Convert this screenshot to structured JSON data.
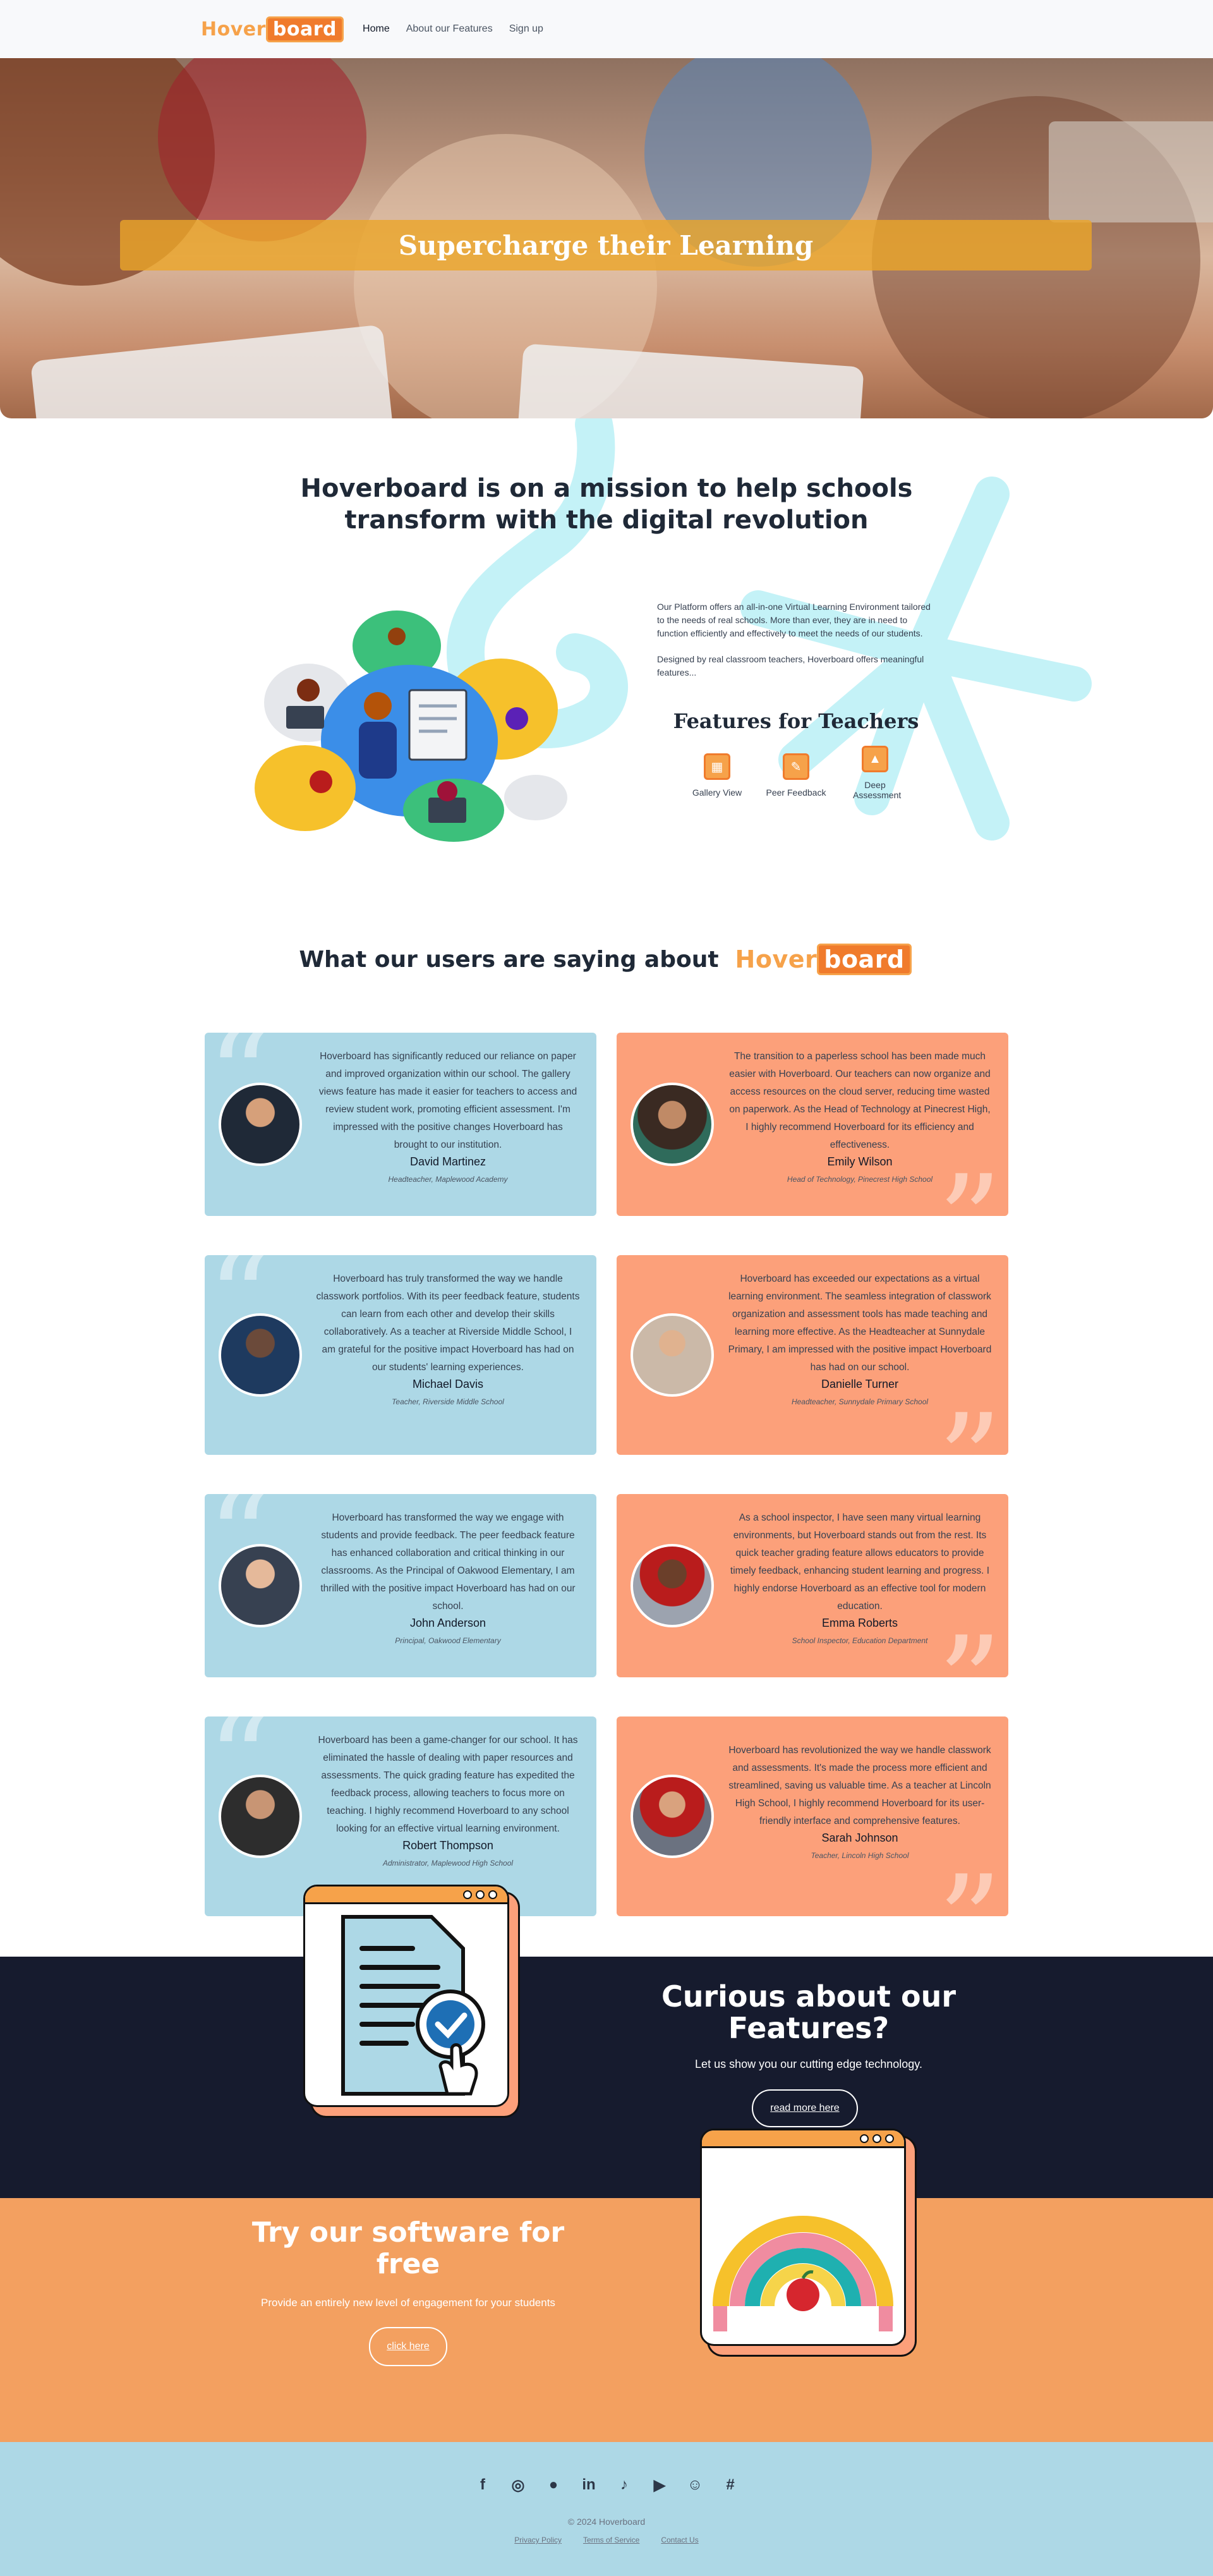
{
  "brand": {
    "part1": "Hover",
    "part2": "board"
  },
  "nav": {
    "home": "Home",
    "features": "About our Features",
    "signup": "Sign up"
  },
  "hero": {
    "title": "Supercharge their Learning"
  },
  "mission": {
    "title_line1": "Hoverboard is on a mission to help schools",
    "title_line2": "transform with the digital revolution",
    "p1": "Our Platform offers an all-in-one Virtual Learning Environment tailored to the needs of real schools. More than ever, they are in need to function efficiently and effectively to meet the needs of our students.",
    "p2": "Designed by real classroom teachers, Hoverboard offers meaningful features...",
    "features_title": "Features for Teachers",
    "features": [
      {
        "label": "Gallery View",
        "icon": "gallery-icon"
      },
      {
        "label": "Peer Feedback",
        "icon": "feedback-icon"
      },
      {
        "label": "Deep Assessment",
        "icon": "chart-icon"
      }
    ]
  },
  "testimonials": {
    "title": "What our users are saying about",
    "items": [
      {
        "quote": "Hoverboard has significantly reduced our reliance on paper and improved organization within our school. The gallery views feature has made it easier for teachers to access and review student work, promoting efficient assessment. I'm impressed with the positive changes Hoverboard has brought to our institution.",
        "name": "David Martinez",
        "role": "Headteacher, Maplewood Academy"
      },
      {
        "quote": "The transition to a paperless school has been made much easier with Hoverboard. Our teachers can now organize and access resources on the cloud server, reducing time wasted on paperwork. As the Head of Technology at Pinecrest High, I highly recommend Hoverboard for its efficiency and effectiveness.",
        "name": "Emily Wilson",
        "role": "Head of Technology, Pinecrest High School"
      },
      {
        "quote": "Hoverboard has truly transformed the way we handle classwork portfolios. With its peer feedback feature, students can learn from each other and develop their skills collaboratively. As a teacher at Riverside Middle School, I am grateful for the positive impact Hoverboard has had on our students' learning experiences.",
        "name": "Michael Davis",
        "role": "Teacher, Riverside Middle School"
      },
      {
        "quote": "Hoverboard has exceeded our expectations as a virtual learning environment. The seamless integration of classwork organization and assessment tools has made teaching and learning more effective. As the Headteacher at Sunnydale Primary, I am impressed with the positive impact Hoverboard has had on our school.",
        "name": "Danielle Turner",
        "role": "Headteacher, Sunnydale Primary School"
      },
      {
        "quote": "Hoverboard has transformed the way we engage with students and provide feedback. The peer feedback feature has enhanced collaboration and critical thinking in our classrooms. As the Principal of Oakwood Elementary, I am thrilled with the positive impact Hoverboard has had on our school.",
        "name": "John Anderson",
        "role": "Principal, Oakwood Elementary"
      },
      {
        "quote": "As a school inspector, I have seen many virtual learning environments, but Hoverboard stands out from the rest. Its quick teacher grading feature allows educators to provide timely feedback, enhancing student learning and progress. I highly endorse Hoverboard as an effective tool for modern education.",
        "name": "Emma Roberts",
        "role": "School Inspector, Education Department"
      },
      {
        "quote": "Hoverboard has been a game-changer for our school. It has eliminated the hassle of dealing with paper resources and assessments. The quick grading feature has expedited the feedback process, allowing teachers to focus more on teaching. I highly recommend Hoverboard to any school looking for an effective virtual learning environment.",
        "name": "Robert Thompson",
        "role": "Administrator, Maplewood High School"
      },
      {
        "quote": "Hoverboard has revolutionized the way we handle classwork and assessments. It's made the process more efficient and streamlined, saving us valuable time. As a teacher at Lincoln High School, I highly recommend Hoverboard for its user-friendly interface and comprehensive features.",
        "name": "Sarah Johnson",
        "role": "Teacher, Lincoln High School"
      }
    ]
  },
  "curious": {
    "title_line1": "Curious about our",
    "title_line2": "Features?",
    "sub": "Let us show you our cutting edge technology.",
    "button": "read more here"
  },
  "try": {
    "title_line1": "Try our software for",
    "title_line2": "free",
    "sub": "Provide an entirely new level of engagement for your students",
    "button": "click here"
  },
  "footer": {
    "social": [
      "facebook-icon",
      "instagram-icon",
      "github-icon",
      "linkedin-icon",
      "tiktok-icon",
      "youtube-icon",
      "discord-icon",
      "slack-icon"
    ],
    "copyright": "© 2024 Hoverboard",
    "links": [
      "Privacy Policy",
      "Terms of Service",
      "Contact Us"
    ]
  },
  "colors": {
    "orange": "#f6a24a",
    "dark_orange": "#f07b2c",
    "light_blue": "#add8e6",
    "salmon": "#fca07a",
    "navy": "#161b2e"
  }
}
